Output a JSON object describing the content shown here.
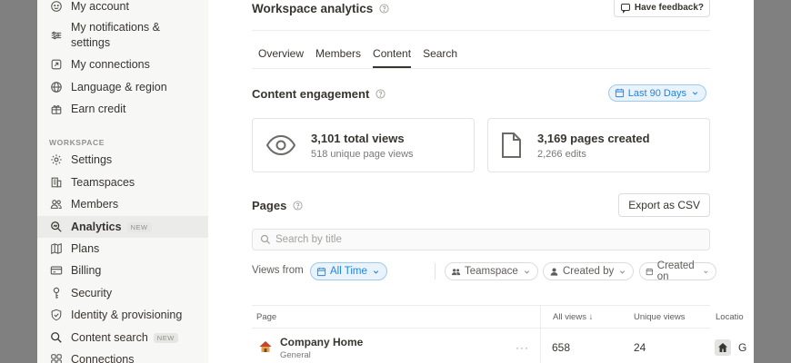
{
  "sidebar": {
    "items_top": [
      {
        "label": "My account",
        "icon": "smile-icon"
      },
      {
        "label": "My notifications & settings",
        "icon": "sliders-icon"
      },
      {
        "label": "My connections",
        "icon": "external-box-icon"
      },
      {
        "label": "Language & region",
        "icon": "globe-icon"
      },
      {
        "label": "Earn credit",
        "icon": "gift-icon"
      }
    ],
    "section_label": "WORKSPACE",
    "items_workspace": [
      {
        "label": "Settings",
        "icon": "gear-icon"
      },
      {
        "label": "Teamspaces",
        "icon": "building-icon"
      },
      {
        "label": "Members",
        "icon": "people-icon"
      },
      {
        "label": "Analytics",
        "icon": "zoom-chart-icon",
        "badge": "NEW",
        "active": true
      },
      {
        "label": "Plans",
        "icon": "map-icon"
      },
      {
        "label": "Billing",
        "icon": "credit-card-icon"
      },
      {
        "label": "Security",
        "icon": "key-icon"
      },
      {
        "label": "Identity & provisioning",
        "icon": "shield-check-icon"
      },
      {
        "label": "Content search",
        "icon": "search-icon",
        "badge": "NEW"
      },
      {
        "label": "Connections",
        "icon": "grid-icon"
      }
    ]
  },
  "main": {
    "title": "Workspace analytics",
    "feedback_label": "Have feedback?",
    "tabs": [
      "Overview",
      "Members",
      "Content",
      "Search"
    ],
    "active_tab": "Content",
    "engagement": {
      "title": "Content engagement",
      "date_range": "Last 90 Days",
      "views": {
        "main": "3,101 total views",
        "sub": "518 unique page views"
      },
      "pages": {
        "main": "3,169 pages created",
        "sub": "2,266 edits"
      }
    },
    "pages": {
      "title": "Pages",
      "export_label": "Export as CSV",
      "search_placeholder": "Search by title",
      "views_from_label": "Views from",
      "filters": {
        "time": "All Time",
        "teamspace": "Teamspace",
        "created_by": "Created by",
        "created_on": "Created on"
      },
      "columns": [
        "Page",
        "All views",
        "Unique views",
        "Locatio"
      ],
      "rows": [
        {
          "title": "Company Home",
          "sub": "General",
          "all_views": "658",
          "unique_views": "24",
          "location": "G"
        }
      ]
    }
  },
  "colors": {
    "accent": "#2383e2",
    "sidebar_bg": "#f7f7f5",
    "overlay": "#808080"
  }
}
